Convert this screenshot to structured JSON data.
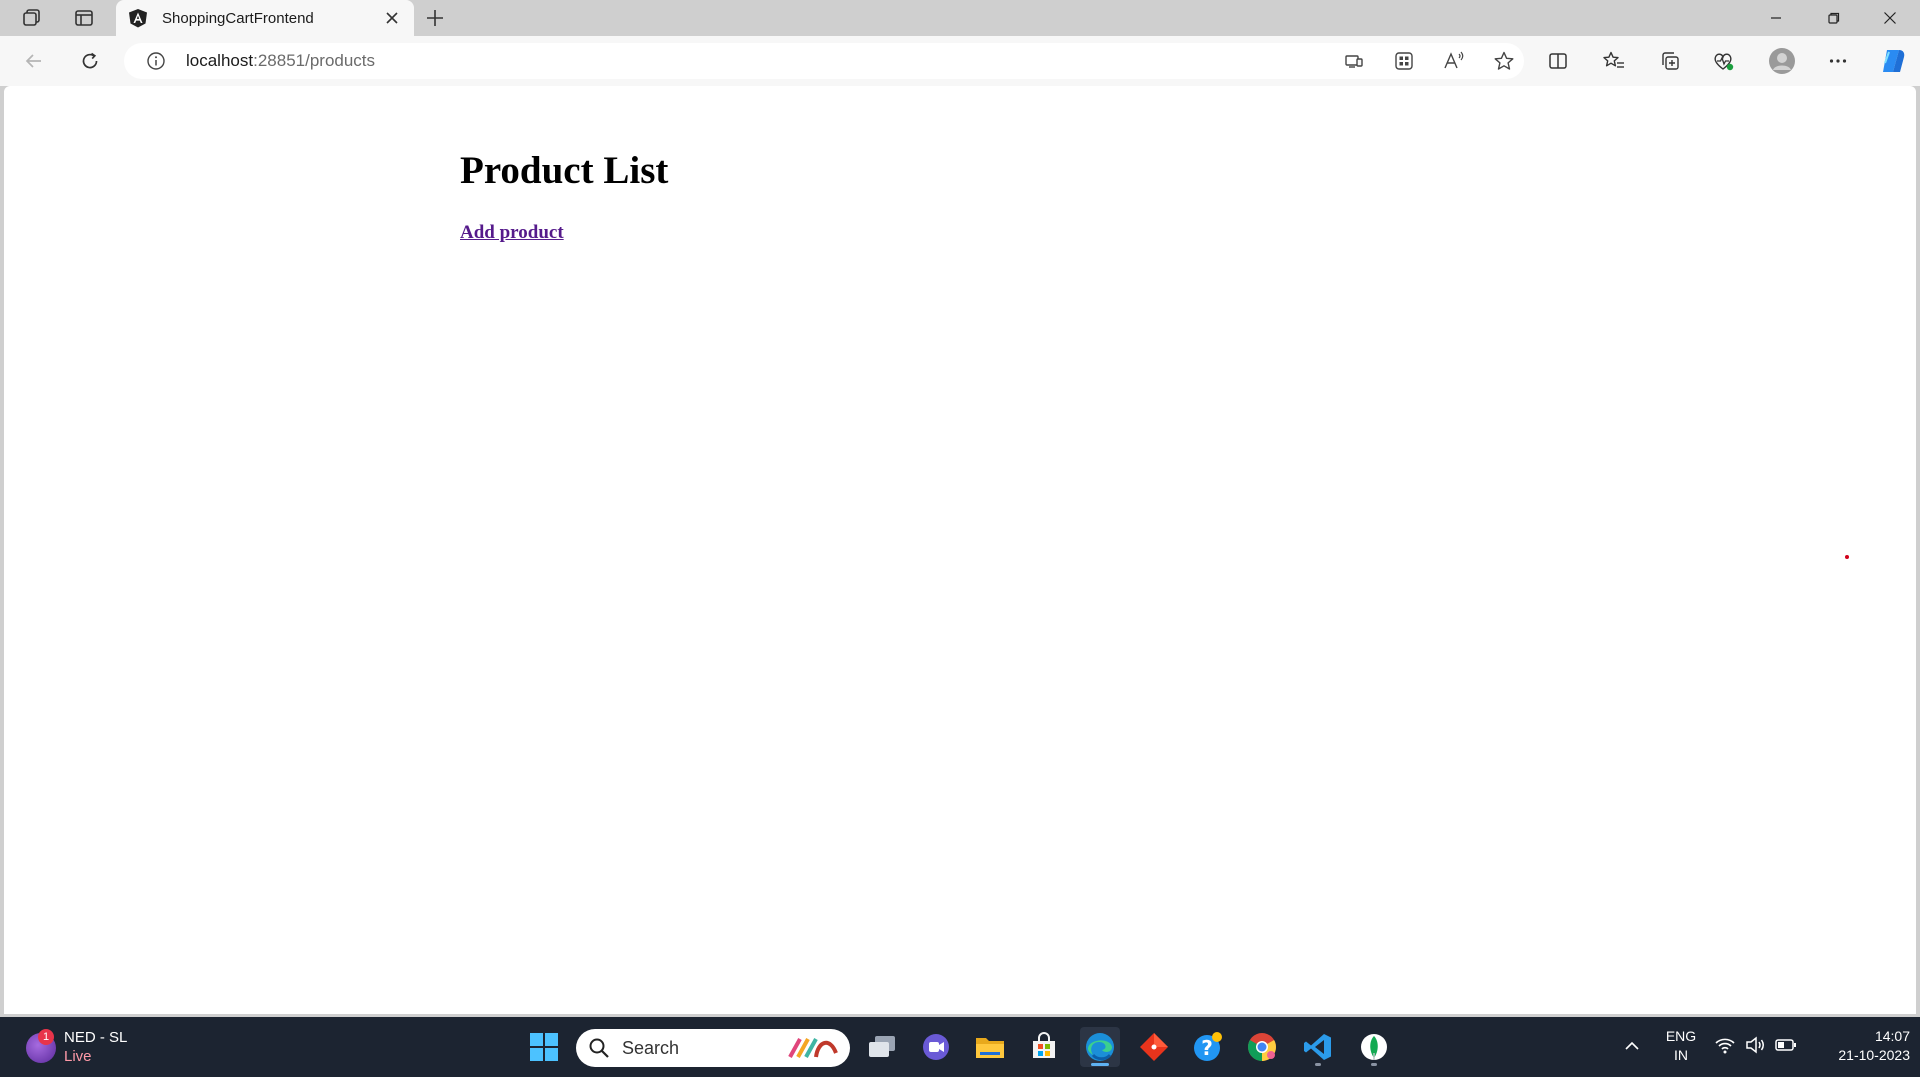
{
  "browser": {
    "tab": {
      "title": "ShoppingCartFrontend"
    },
    "address": {
      "host": "localhost",
      "rest": ":28851/products"
    }
  },
  "page": {
    "heading": "Product List",
    "add_link": "Add product"
  },
  "taskbar": {
    "weather": {
      "badge": "1",
      "name": "NED - SL",
      "status": "Live"
    },
    "search": {
      "placeholder": "Search"
    },
    "language": {
      "line1": "ENG",
      "line2": "IN"
    },
    "clock": {
      "time": "14:07",
      "date": "21-10-2023"
    },
    "apps": [
      "start-icon",
      "task-view-icon",
      "teams-chat-icon",
      "file-explorer-icon",
      "microsoft-store-icon",
      "edge-icon",
      "git-icon",
      "help-icon",
      "chrome-icon",
      "vscode-icon",
      "mongodb-icon"
    ]
  },
  "colors": {
    "link_visited": "#551a8b",
    "taskbar_bg": "#1c2431",
    "chrome_bg": "#cfcfcf",
    "toolbar_bg": "#f7f7f7",
    "copilot": "#1a73e8"
  }
}
